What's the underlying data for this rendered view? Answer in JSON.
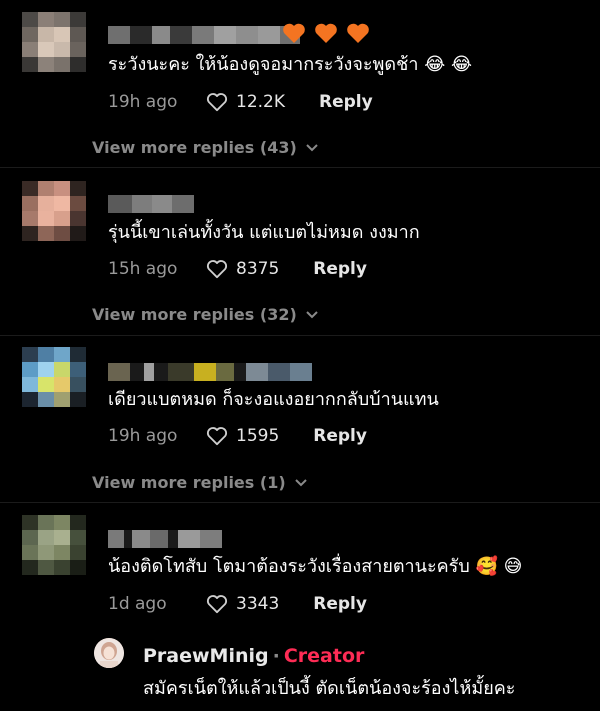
{
  "comments": [
    {
      "text": "ระวังนะคะ ให้น้องดูจอมากระวังจะพูดช้า",
      "emojis": "😂 😂",
      "time": "19h ago",
      "likes": "12.2K",
      "reply": "Reply",
      "view_more": "View more replies (43)"
    },
    {
      "text": "รุ่นนี้เขาเล่นทั้งวัน แต่แบตไม่หมด งงมาก",
      "emojis": "",
      "time": "15h ago",
      "likes": "8375",
      "reply": "Reply",
      "view_more": "View more replies (32)"
    },
    {
      "text": "เดียวแบตหมด ก็จะงอแงอยากกลับบ้านแทน",
      "emojis": "",
      "time": "19h ago",
      "likes": "1595",
      "reply": "Reply",
      "view_more": "View more replies (1)"
    },
    {
      "text": "น้องติดโทสับ โตมาต้องระวังเรื่องสายตานะครับ",
      "emojis": "🥰 😅",
      "time": "1d ago",
      "likes": "3343",
      "reply": "Reply"
    }
  ],
  "creator_reply": {
    "name": "PraewMinig",
    "separator": "·",
    "tag": "Creator",
    "text": "สมัครเน็ตให้แล้วเป็นงี้ ตัดเน็ตน้องจะร้องไห้มั้ยคะ"
  },
  "colors": {
    "background": "#000000",
    "creator_tag": "#fe2c55",
    "heart_emoji": "#f47421",
    "muted_text": "#9a9a9a"
  },
  "icons": {
    "like": "heart-outline-icon",
    "expand": "chevron-down-icon",
    "reaction": "orange-heart-emoji"
  }
}
